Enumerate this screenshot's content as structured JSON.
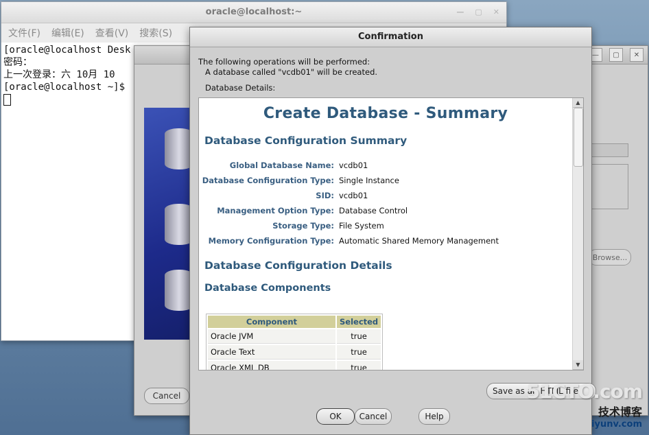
{
  "terminal": {
    "title": "oracle@localhost:~",
    "menu": [
      "文件(F)",
      "编辑(E)",
      "查看(V)",
      "搜索(S)"
    ],
    "lines": [
      "[oracle@localhost Desk",
      "密码：",
      "上一次登录：六 10月 10",
      "[oracle@localhost ~]$"
    ]
  },
  "dbca_window": {
    "cancel_label": "Cancel",
    "browse_label": "Browse..."
  },
  "dialog": {
    "title": "Confirmation",
    "intro_line1": "The following operations will be performed:",
    "intro_line2": "A database called \"vcdb01\" will be created.",
    "details_label": "Database Details:",
    "summary": {
      "main_heading": "Create Database - Summary",
      "config_summary_heading": "Database Configuration Summary",
      "fields": [
        {
          "label": "Global Database Name:",
          "value": "vcdb01"
        },
        {
          "label": "Database Configuration Type:",
          "value": "Single Instance"
        },
        {
          "label": "SID:",
          "value": "vcdb01"
        },
        {
          "label": "Management Option Type:",
          "value": "Database Control"
        },
        {
          "label": "Storage Type:",
          "value": "File System"
        },
        {
          "label": "Memory Configuration Type:",
          "value": "Automatic Shared Memory Management"
        }
      ],
      "config_details_heading": "Database Configuration Details",
      "components_heading": "Database Components",
      "components_table": {
        "headers": [
          "Component",
          "Selected"
        ],
        "rows": [
          [
            "Oracle JVM",
            "true"
          ],
          [
            "Oracle Text",
            "true"
          ],
          [
            "Oracle XML DB",
            "true"
          ]
        ]
      }
    },
    "save_html_label": "Save as an HTML file",
    "ok_label": "OK",
    "cancel_label": "Cancel",
    "help_label": "Help"
  },
  "watermark": {
    "line1": "51CTO.com",
    "line2": "技术博客",
    "line3": "iyunv.com"
  }
}
